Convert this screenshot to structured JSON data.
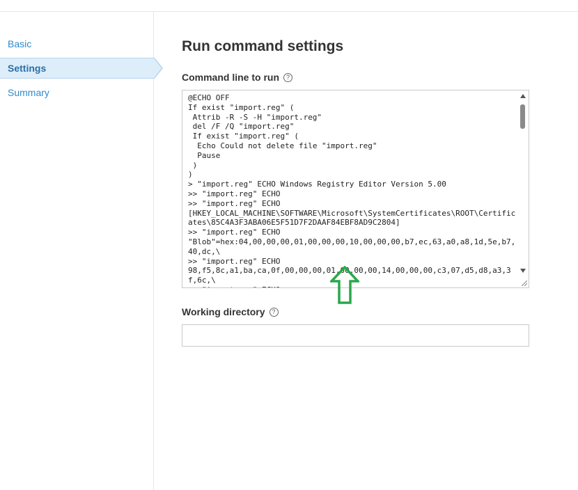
{
  "sidebar": {
    "items": [
      {
        "label": "Basic",
        "active": false
      },
      {
        "label": "Settings",
        "active": true
      },
      {
        "label": "Summary",
        "active": false
      }
    ]
  },
  "main": {
    "title": "Run command settings",
    "command_line": {
      "label": "Command line to run",
      "help_glyph": "?",
      "value": "@ECHO OFF\nIf exist \"import.reg\" (\n Attrib -R -S -H \"import.reg\"\n del /F /Q \"import.reg\"\n If exist \"import.reg\" (\n  Echo Could not delete file \"import.reg\"\n  Pause\n )\n)\n> \"import.reg\" ECHO Windows Registry Editor Version 5.00\n>> \"import.reg\" ECHO\n>> \"import.reg\" ECHO\n[HKEY_LOCAL_MACHINE\\SOFTWARE\\Microsoft\\SystemCertificates\\ROOT\\Certificates\\85C4A3F3ABA06E5F51D7F2DAAF84EBF8AD9C2804]\n>> \"import.reg\" ECHO\n\"Blob\"=hex:04,00,00,00,01,00,00,00,10,00,00,00,b7,ec,63,a0,a8,1d,5e,b7,40,dc,\\\n>> \"import.reg\" ECHO\n98,f5,8c,a1,ba,ca,0f,00,00,00,01,00,00,00,14,00,00,00,c3,07,d5,d8,a3,3f,6c,\\\n>> \"import.reg\" ECHO"
    },
    "working_directory": {
      "label": "Working directory",
      "help_glyph": "?",
      "value": "",
      "placeholder": ""
    }
  },
  "annotation": {
    "arrow_color": "#2aa84a"
  },
  "colors": {
    "link": "#2e8bcc",
    "active_bg": "#ddeefa",
    "active_border": "#b4d4ef"
  }
}
